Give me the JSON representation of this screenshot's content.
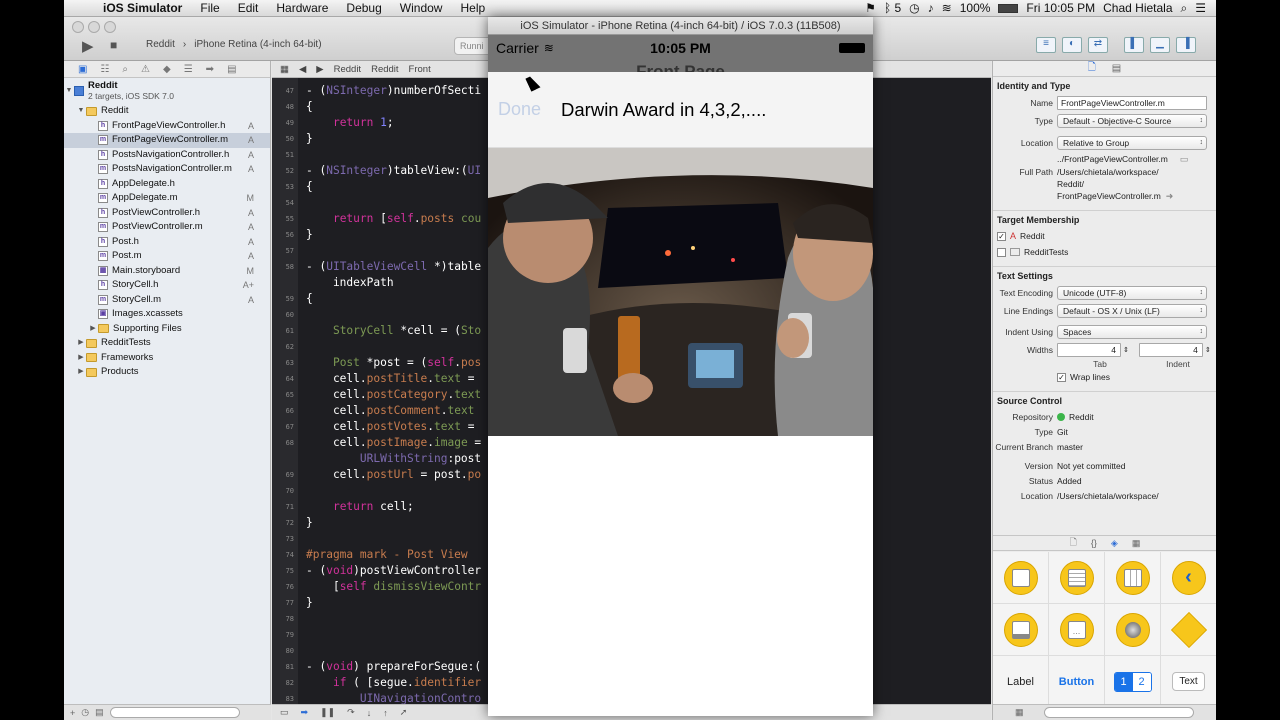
{
  "menubar": {
    "app": "iOS Simulator",
    "items": [
      "File",
      "Edit",
      "Hardware",
      "Debug",
      "Window",
      "Help"
    ],
    "status_right": {
      "bt": "5",
      "battery": "100%",
      "clock": "Fri 10:05 PM",
      "user": "Chad Hietala"
    }
  },
  "toolbar": {
    "scheme_target": "Reddit",
    "scheme_device": "iPhone Retina (4-inch 64-bit)",
    "status": "Runni"
  },
  "navigator": {
    "project": {
      "name": "Reddit",
      "subtitle": "2 targets, iOS SDK 7.0"
    },
    "items": [
      {
        "name": "Reddit",
        "kind": "folder",
        "depth": 1,
        "status": "",
        "open": true
      },
      {
        "name": "FrontPageViewController.h",
        "kind": "h",
        "depth": 2,
        "status": "A"
      },
      {
        "name": "FrontPageViewController.m",
        "kind": "m",
        "depth": 2,
        "status": "A",
        "selected": true
      },
      {
        "name": "PostsNavigationController.h",
        "kind": "h",
        "depth": 2,
        "status": "A"
      },
      {
        "name": "PostsNavigationController.m",
        "kind": "m",
        "depth": 2,
        "status": "A"
      },
      {
        "name": "AppDelegate.h",
        "kind": "h",
        "depth": 2,
        "status": ""
      },
      {
        "name": "AppDelegate.m",
        "kind": "m",
        "depth": 2,
        "status": "M"
      },
      {
        "name": "PostViewController.h",
        "kind": "h",
        "depth": 2,
        "status": "A"
      },
      {
        "name": "PostViewController.m",
        "kind": "m",
        "depth": 2,
        "status": "A"
      },
      {
        "name": "Post.h",
        "kind": "h",
        "depth": 2,
        "status": "A"
      },
      {
        "name": "Post.m",
        "kind": "m",
        "depth": 2,
        "status": "A"
      },
      {
        "name": "Main.storyboard",
        "kind": "sb",
        "depth": 2,
        "status": "M"
      },
      {
        "name": "StoryCell.h",
        "kind": "h",
        "depth": 2,
        "status": "A+"
      },
      {
        "name": "StoryCell.m",
        "kind": "m",
        "depth": 2,
        "status": "A"
      },
      {
        "name": "Images.xcassets",
        "kind": "assets",
        "depth": 2,
        "status": ""
      },
      {
        "name": "Supporting Files",
        "kind": "folder",
        "depth": 2,
        "status": ""
      },
      {
        "name": "RedditTests",
        "kind": "folder",
        "depth": 1,
        "status": ""
      },
      {
        "name": "Frameworks",
        "kind": "folder",
        "depth": 1,
        "status": ""
      },
      {
        "name": "Products",
        "kind": "folder",
        "depth": 1,
        "status": ""
      }
    ]
  },
  "editor": {
    "jumpbar": [
      "Reddit",
      "Reddit",
      "Front"
    ],
    "lines": [
      {
        "n": "47",
        "html": "- (<span class='t'>NSInteger</span>)numberOfSecti"
      },
      {
        "n": "48",
        "html": "{"
      },
      {
        "n": "49",
        "html": "    <span class='k'>return</span> <span class='n'>1</span>;"
      },
      {
        "n": "50",
        "html": "}"
      },
      {
        "n": "51",
        "html": ""
      },
      {
        "n": "52",
        "html": "- (<span class='t'>NSInteger</span>)tableView:(<span class='t'>UI</span>                                    <span class='t'>r</span>)section"
      },
      {
        "n": "53",
        "html": "{"
      },
      {
        "n": "54",
        "html": ""
      },
      {
        "n": "55",
        "html": "    <span class='k'>return</span> [<span class='k'>self</span>.<span class='pr'>posts</span> <span class='p'>cou</span>"
      },
      {
        "n": "56",
        "html": "}"
      },
      {
        "n": "57",
        "html": ""
      },
      {
        "n": "58",
        "html": "- (<span class='t'>UITableViewCell</span> *)table                                    <span class='t'>NSIndexPath</span> *)"
      },
      {
        "n": "",
        "html": "    indexPath"
      },
      {
        "n": "59",
        "html": "{"
      },
      {
        "n": "60",
        "html": ""
      },
      {
        "n": "61",
        "html": "    <span class='p'>StoryCell</span> *cell = (<span class='p'>Sto</span>                                    <span class='s'>:@\"StoryCell\"</span>];"
      },
      {
        "n": "62",
        "html": ""
      },
      {
        "n": "63",
        "html": "    <span class='p'>Post</span> *post = (<span class='k'>self</span>.<span class='pr'>pos</span>"
      },
      {
        "n": "64",
        "html": "    cell.<span class='pr'>postTitle</span>.<span class='p'>text</span> ="
      },
      {
        "n": "65",
        "html": "    cell.<span class='pr'>postCategory</span>.<span class='p'>text</span>"
      },
      {
        "n": "66",
        "html": "    cell.<span class='pr'>postComment</span>.<span class='p'>text</span>                                    <span class='pr'>ount</span>];"
      },
      {
        "n": "67",
        "html": "    cell.<span class='pr'>postVotes</span>.<span class='p'>text</span> =                                    ;"
      },
      {
        "n": "68",
        "html": "    cell.<span class='pr'>postImage</span>.<span class='p'>image</span> =                                   :[<span class='t'>NSURL</span>"
      },
      {
        "n": "",
        "html": "        <span class='t'>URLWithString</span>:post"
      },
      {
        "n": "69",
        "html": "    cell.<span class='pr'>postUrl</span> = post.<span class='pr'>po</span>"
      },
      {
        "n": "70",
        "html": ""
      },
      {
        "n": "71",
        "html": "    <span class='k'>return</span> cell;"
      },
      {
        "n": "72",
        "html": "}"
      },
      {
        "n": "73",
        "html": ""
      },
      {
        "n": "74",
        "html": "<span class='pr'>#pragma mark - Post View </span>"
      },
      {
        "n": "75",
        "html": "- (<span class='k'>void</span>)postViewController"
      },
      {
        "n": "76",
        "html": "    [<span class='k'>self</span> <span class='p'>dismissViewContr</span>"
      },
      {
        "n": "77",
        "html": "}"
      },
      {
        "n": "78",
        "html": ""
      },
      {
        "n": "79",
        "html": ""
      },
      {
        "n": "80",
        "html": ""
      },
      {
        "n": "81",
        "html": "- (<span class='k'>void</span>) prepareForSegue:("
      },
      {
        "n": "82",
        "html": "    <span class='k'>if</span> ( [segue.<span class='pr'>identifier</span>"
      },
      {
        "n": "83",
        "html": "        <span class='t'>UINavigationContro</span>                                     <span class='t'>troller</span>;"
      }
    ]
  },
  "inspector": {
    "identity_title": "Identity and Type",
    "name_label": "Name",
    "name": "FrontPageViewController.m",
    "type_label": "Type",
    "type": "Default - Objective-C Source",
    "location_label": "Location",
    "location": "Relative to Group",
    "location_path": "../FrontPageViewController.m",
    "fullpath_label": "Full Path",
    "fullpath": [
      "/Users/chietala/workspace/",
      "Reddit/",
      "FrontPageViewController.m"
    ],
    "target_title": "Target Membership",
    "targets": [
      {
        "name": "Reddit",
        "checked": true
      },
      {
        "name": "RedditTests",
        "checked": false
      }
    ],
    "text_title": "Text Settings",
    "encoding_label": "Text Encoding",
    "encoding": "Unicode (UTF-8)",
    "endings_label": "Line Endings",
    "endings": "Default - OS X / Unix (LF)",
    "indent_label": "Indent Using",
    "indent": "Spaces",
    "widths_label": "Widths",
    "tab_width": "4",
    "indent_width": "4",
    "tab_label": "Tab",
    "indent_sub_label": "Indent",
    "wrap_label": "Wrap lines",
    "source_title": "Source Control",
    "repo_label": "Repository",
    "repo": "Reddit",
    "sc_type_label": "Type",
    "sc_type": "Git",
    "branch_label": "Current Branch",
    "branch": "master",
    "version_label": "Version",
    "version": "Not yet committed",
    "status_label": "Status",
    "status": "Added",
    "sc_location_label": "Location",
    "sc_location": "/Users/chietala/workspace/",
    "lib_label": "Label",
    "lib_button": "Button",
    "lib_seg": [
      "1",
      "2"
    ],
    "lib_text": "Text"
  },
  "simulator": {
    "title": "iOS Simulator - iPhone Retina (4-inch 64-bit) / iOS 7.0.3 (11B508)",
    "carrier": "Carrier",
    "time": "10:05 PM",
    "nav_title": "Front Page",
    "done": "Done",
    "post_title": "Darwin Award in 4,3,2,...."
  },
  "colors": {
    "accent": "#1a73e8",
    "editor_bg": "#1e1e22",
    "library_yellow": "#f7c61b"
  }
}
